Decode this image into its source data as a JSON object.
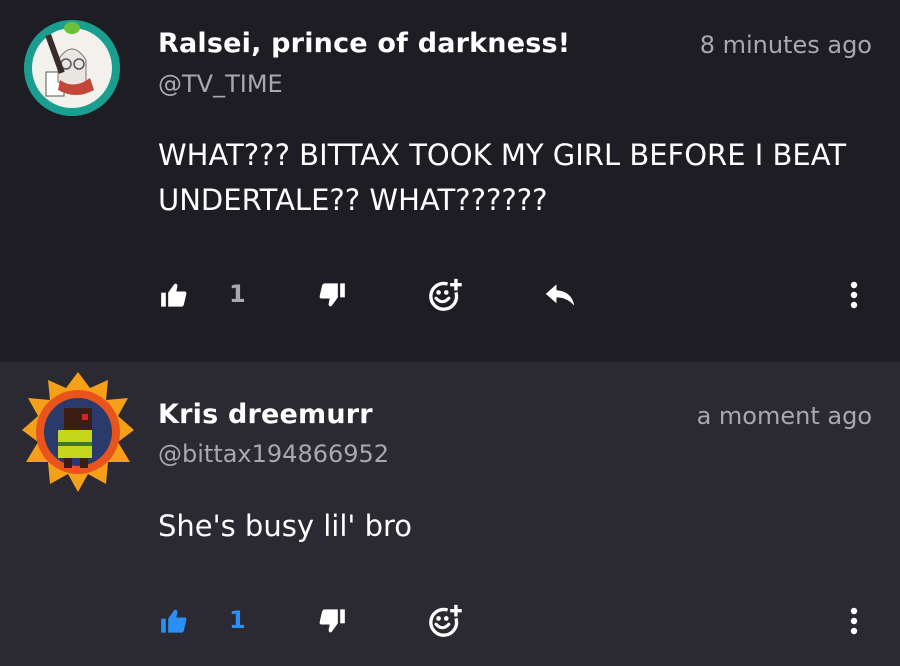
{
  "comments": [
    {
      "username": "Ralsei, prince of darkness!",
      "handle": "@TV_TIME",
      "time": "8 minutes ago",
      "text": "WHAT??? BITTAX TOOK MY GIRL BEFORE I BEAT UNDERTALE?? WHAT??????",
      "likes": "1",
      "liked": false,
      "avatar_border_color": "#1a9e8f"
    },
    {
      "username": "Kris dreemurr",
      "handle": "@bittax194866952",
      "time": "a moment ago",
      "text": "She's busy lil' bro",
      "likes": "1",
      "liked": true,
      "avatar_accent_color": "#f5a019"
    }
  ],
  "colors": {
    "background": "#1f1d24",
    "highlight_background": "#2b2931",
    "secondary_text": "#a9a8ae",
    "like_active": "#2a8ff7",
    "icon_default": "#ffffff"
  }
}
